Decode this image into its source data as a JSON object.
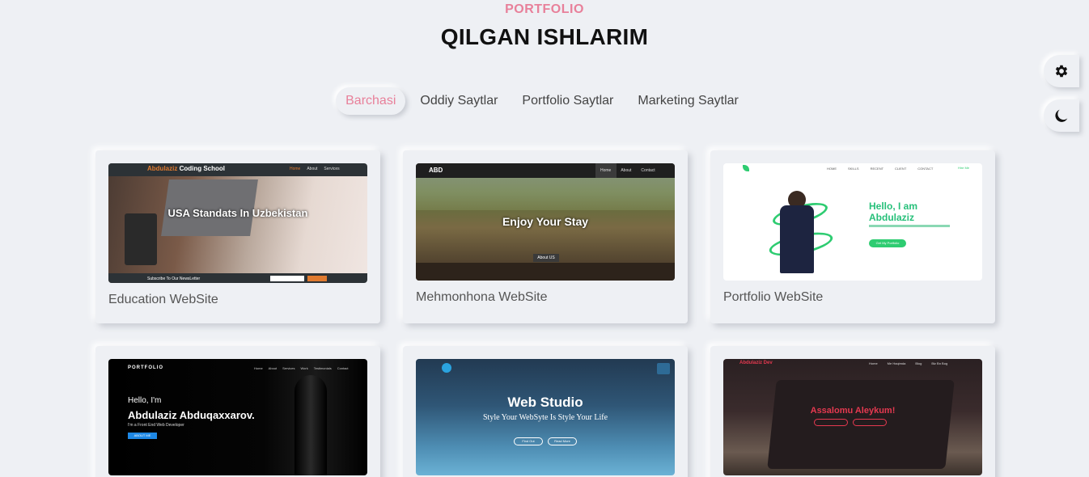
{
  "header": {
    "eyebrow": "PORTFOLIO",
    "title": "QILGAN ISHLARIM"
  },
  "filters": [
    {
      "label": "Barchasi",
      "active": true
    },
    {
      "label": "Oddiy Saytlar",
      "active": false
    },
    {
      "label": "Portfolio Saytlar",
      "active": false
    },
    {
      "label": "Marketing Saytlar",
      "active": false
    }
  ],
  "side": {
    "settings_icon": "gear-icon",
    "theme_icon": "moon-icon"
  },
  "colors": {
    "accent": "#e8809a",
    "background": "#eef0f4",
    "green": "#2ecc71"
  },
  "projects": [
    {
      "caption": "Education WebSite",
      "thumb": {
        "brand": "Abdulaziz",
        "brand2": "Coding School",
        "nav": [
          "Home",
          "About",
          "Services"
        ],
        "headline": "USA Standats In Uzbekistan",
        "footer": "Subscribe To Our NewsLetter"
      }
    },
    {
      "caption": "Mehmonhona WebSite",
      "thumb": {
        "brand": "ABD",
        "nav": [
          "Home",
          "About",
          "Contact"
        ],
        "headline": "Enjoy Your Stay",
        "button": "About US"
      }
    },
    {
      "caption": "Portfolio WebSite",
      "thumb": {
        "nav": [
          "HOME",
          "SKILLS",
          "RECENT",
          "CLIENT",
          "CONTACT"
        ],
        "cta": "Hire Me",
        "headline1": "Hello, I am",
        "headline2": "Abdulaziz",
        "button": "Get My Portfolio"
      }
    },
    {
      "caption": "",
      "thumb": {
        "brand": "PORTFOLIO",
        "nav": [
          "Home",
          "About",
          "Services",
          "Work",
          "Testimonials",
          "Contact"
        ],
        "hello": "Hello, I'm",
        "name": "Abdulaziz Abduqaxxarov.",
        "role": "I'm a Front End Web Developer",
        "button": "ABOUT ME"
      }
    },
    {
      "caption": "",
      "thumb": {
        "headline": "Web Studio",
        "sub": "Style Your WebSyte Is Style Your Life",
        "btn1": "Find Out",
        "btn2": "Read More"
      }
    },
    {
      "caption": "",
      "thumb": {
        "brand": "Abdulaziz Dev",
        "nav": [
          "Home",
          "Me Haqimda",
          "Blog",
          "Biz Bn Bog"
        ],
        "headline": "Assalomu Aleykum!"
      }
    }
  ]
}
